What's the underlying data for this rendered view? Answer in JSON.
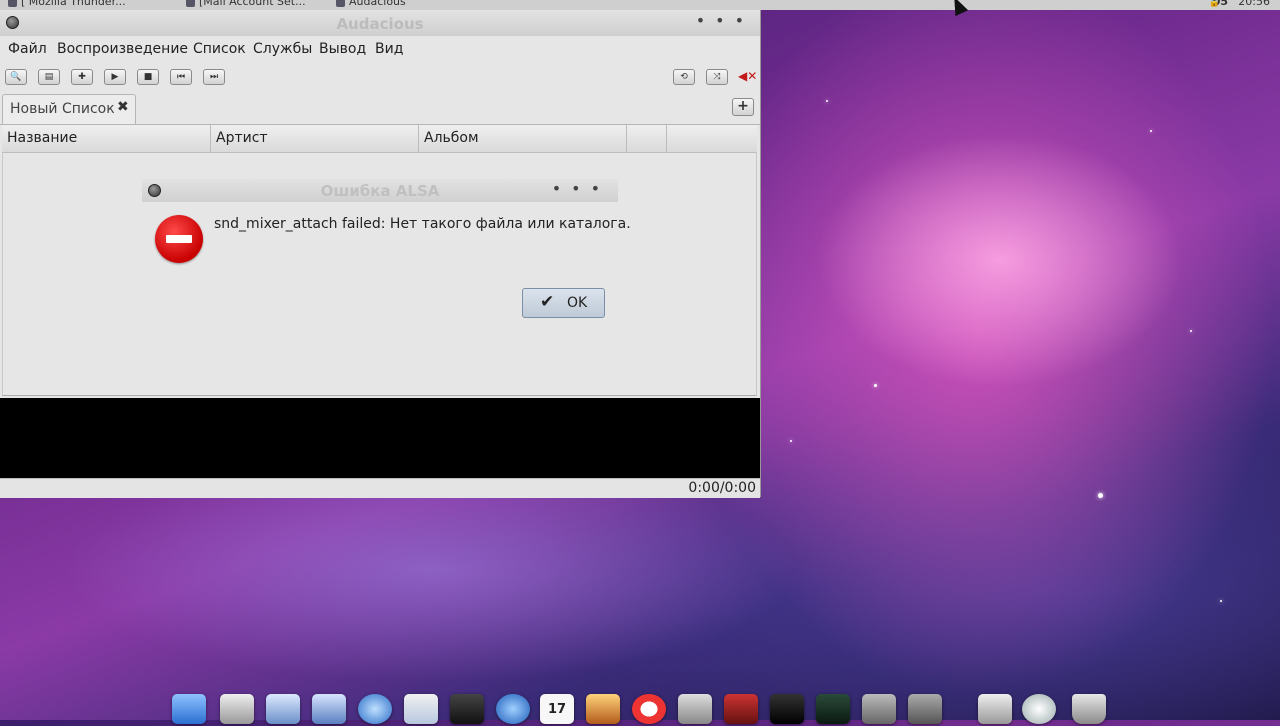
{
  "top_panel": {
    "tasks": [
      {
        "label": "[ Mozilla Thunder..."
      },
      {
        "label": "[Mail Account Set..."
      },
      {
        "label": "Audacious"
      }
    ],
    "tray_number": "05",
    "clock": "20:56"
  },
  "window": {
    "title": "Audacious",
    "menu": [
      "Файл",
      "Воспроизведение",
      "Список",
      "Службы",
      "Вывод",
      "Вид"
    ],
    "toolbar": {
      "left_buttons": [
        "search-icon",
        "open-icon",
        "add-icon",
        "play-icon",
        "stop-icon",
        "previous-icon",
        "next-icon"
      ],
      "right_buttons": [
        "repeat-icon",
        "shuffle-icon",
        "mute-icon"
      ]
    },
    "tab": {
      "label": "Новый Список",
      "close": "✖"
    },
    "add_tab": "+",
    "columns": [
      "Название",
      "Артист",
      "Альбом",
      "",
      ""
    ],
    "status_time": "0:00/0:00"
  },
  "dialog": {
    "title": "Ошибка ALSA",
    "message": "snd_mixer_attach failed: Нет такого файла или каталога.",
    "ok_label": "OK",
    "icon": "error-stop-icon"
  },
  "dock": {
    "icons": [
      "finder-icon",
      "calculator-icon",
      "document-icon",
      "image-icon",
      "safari-icon",
      "preview-icon",
      "camera-icon",
      "itunes-icon",
      "calendar-icon",
      "photos-icon",
      "lifebuoy-icon",
      "tools-icon",
      "book-icon",
      "terminal-icon",
      "activity-monitor-icon",
      "system-preferences-icon",
      "printer-icon",
      "archive-icon",
      "time-machine-icon",
      "trash-icon"
    ],
    "calendar_day": "17"
  }
}
